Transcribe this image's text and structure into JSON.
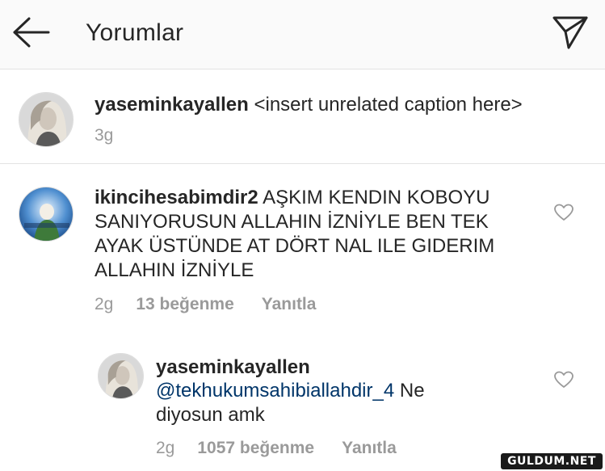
{
  "header": {
    "title": "Yorumlar",
    "back_icon": "arrow-left-icon",
    "send_icon": "paper-plane-icon"
  },
  "caption": {
    "username": "yaseminkayallen",
    "text": "<insert unrelated caption here>",
    "time": "3g"
  },
  "comment": {
    "username": "ikincihesabimdir2",
    "text": "AŞKIM KENDIN KOBOYU SANIYORUSUN ALLAHIN İZNİYLE BEN TEK AYAK ÜSTÜNDE AT DÖRT NAL ILE GIDERIM ALLAHIN İZNİYLE",
    "time": "2g",
    "likes": "13 beğenme",
    "reply_label": "Yanıtla"
  },
  "reply": {
    "username": "yaseminkayallen",
    "mention": "@tekhukumsahibiallahdir_4",
    "text": "Ne diyosun amk",
    "time": "2g",
    "likes": "1057 beğenme",
    "reply_label": "Yanıtla"
  },
  "watermark": {
    "text": "GULDUM.NET"
  },
  "colors": {
    "header_bg": "#fafafa",
    "text": "#262626",
    "muted": "#9a9a9a",
    "mention": "#003569",
    "divider": "#e3e3e3"
  }
}
